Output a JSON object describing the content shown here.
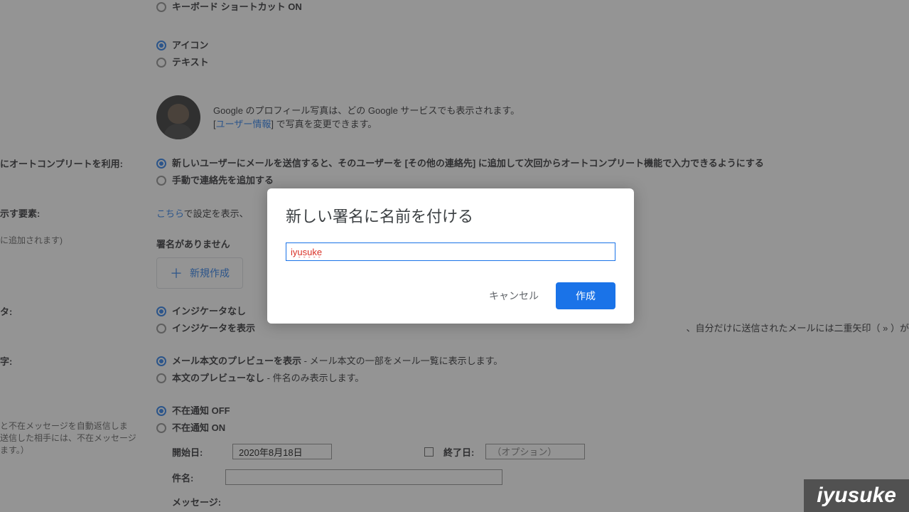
{
  "shortcuts": {
    "on": "キーボード ショートカット ON"
  },
  "buttons_style": {
    "icon": "アイコン",
    "text": "テキスト"
  },
  "profile": {
    "line1": "Google のプロフィール写真は、どの Google サービスでも表示されます。",
    "line2a": "[",
    "line2link": "ユーザー情報",
    "line2b": "] で写真を変更できます。"
  },
  "autocomplete": {
    "left_label": "にオートコンプリートを利用:",
    "opt1": "新しいユーザーにメールを送信すると、そのユーザーを [その他の連絡先] に追加して次回からオートコンプリート機能で入力できるようにする",
    "opt2": "手動で連絡先を追加する"
  },
  "display_elements": {
    "left_label": "示す要素:",
    "text_prefix": "こちら",
    "text_suffix": "で設定を表示、"
  },
  "signature": {
    "left_sub": "に追加されます)",
    "none": "署名がありません",
    "new_btn": "新規作成"
  },
  "indicator": {
    "left_label": "タ:",
    "none": "インジケータなし",
    "show_a": "インジケータを表示",
    "show_b": "、自分だけに送信されたメールには二重矢印（ » ）が"
  },
  "preview": {
    "left_label": "字:",
    "show_a": "メール本文のプレビューを表示",
    "show_b": " - メール本文の一部をメール一覧に表示します。",
    "none_a": "本文のプレビューなし",
    "none_b": " - 件名のみ表示します。"
  },
  "vacation": {
    "off": "不在通知 OFF",
    "on": "不在通知 ON",
    "left_sub1": "と不在メッセージを自動返信しま",
    "left_sub2": "送信した相手には、不在メッセージ",
    "left_sub3": "ます。）",
    "start_label": "開始日:",
    "start_value": "2020年8月18日",
    "end_label": "終了日:",
    "end_placeholder": "（オプション）",
    "subject_label": "件名:",
    "message_label": "メッセージ:"
  },
  "modal": {
    "title": "新しい署名に名前を付ける",
    "input_value": "iyusuke",
    "cancel": "キャンセル",
    "create": "作成"
  },
  "watermark": "iyusuke"
}
